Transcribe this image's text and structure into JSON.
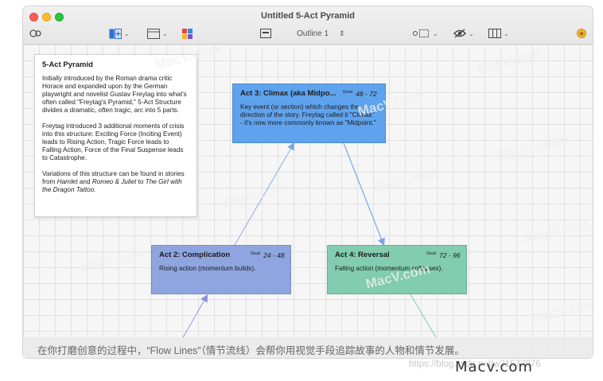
{
  "window": {
    "title": "Untitled 5-Act Pyramid"
  },
  "toolbar": {
    "outline_label": "Outline 1",
    "icons": [
      "view-icon",
      "add-icon",
      "layout-icon",
      "color-icon",
      "outline-icon",
      "group-icon",
      "eye-icon",
      "columns-icon",
      "star-icon"
    ]
  },
  "note": {
    "title": "5-Act Pyramid",
    "paragraph_1": "Initially introduced by the Roman drama critic Horace and expanded upon by the German playwright and novelist Gustav Freytag into what's often called \"Freytag's Pyramid,\" 5-Act Structure divides a dramatic, often tragic, arc into 5 parts.",
    "paragraph_2": "Freytag introduced 3 additional moments of crisis into this structure: Exciting Force (Inciting Event) leads to Rising Action, Tragic Force leads to Falling Action, Force of the Final Suspense leads to Catastrophe.",
    "p3_prefix": "Variations of this structure can be found in stories from ",
    "p3_em1": "Hamlet",
    "p3_mid1": " and ",
    "p3_em2": "Romeo & Juliet",
    "p3_mid2": " to ",
    "p3_em3": "The Girl with the Dragon Tattoo.",
    "p3_suffix": ""
  },
  "cards": {
    "act3": {
      "title": "Act 3: Climax (aka Midpo...",
      "goal_label": "Goal:",
      "goal": "48 - 72",
      "body": "Key event (or section) which changes the direction of the story. Freytag called it \"Climax\" - it's now more commonly known as \"Midpoint.\"",
      "color": "#5fa3ee"
    },
    "act2": {
      "title": "Act 2: Complication",
      "goal_label": "Goal:",
      "goal": "24 - 48",
      "body": "Rising action (momentum builds).",
      "color": "#8fa5e0"
    },
    "act4": {
      "title": "Act 4: Reversal",
      "goal_label": "Goal:",
      "goal": "72 - 96",
      "body": "Falling action (momentum collapses).",
      "color": "#82ccaf"
    }
  },
  "caption": {
    "text": "在你打磨创意的过程中，“Flow Lines”（情节流线）会帮你用视觉手段追踪故事的人物和情节发展。",
    "watermark": "Macv.com",
    "url": "https://blog.csdn.net/w21577076"
  },
  "watermarks": [
    "MacV.com",
    "MacV.com",
    "MacV.com",
    "MacV.com",
    "MacV.com",
    "MacV.com",
    "MacV.com",
    "MacV.com",
    "MacV.com",
    "MacV.com"
  ]
}
